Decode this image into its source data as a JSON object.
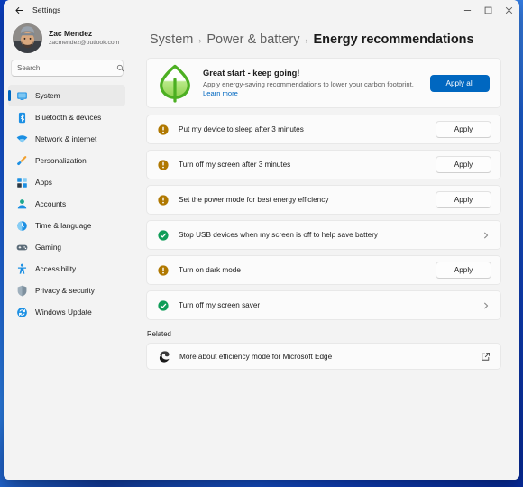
{
  "window": {
    "title": "Settings",
    "back_icon": "back-arrow-icon",
    "minimize_label": "Minimize",
    "maximize_label": "Maximize",
    "close_label": "Close"
  },
  "profile": {
    "name": "Zac Mendez",
    "email": "zacmendez@outlook.com",
    "avatar_name": "user-avatar"
  },
  "search": {
    "placeholder": "Search",
    "value": "",
    "icon": "search-icon"
  },
  "sidebar": {
    "items": [
      {
        "label": "System",
        "icon": "monitor-icon",
        "active": true
      },
      {
        "label": "Bluetooth & devices",
        "icon": "bluetooth-icon",
        "active": false
      },
      {
        "label": "Network & internet",
        "icon": "wifi-icon",
        "active": false
      },
      {
        "label": "Personalization",
        "icon": "paintbrush-icon",
        "active": false
      },
      {
        "label": "Apps",
        "icon": "apps-grid-icon",
        "active": false
      },
      {
        "label": "Accounts",
        "icon": "person-icon",
        "active": false
      },
      {
        "label": "Time & language",
        "icon": "clock-globe-icon",
        "active": false
      },
      {
        "label": "Gaming",
        "icon": "gamepad-icon",
        "active": false
      },
      {
        "label": "Accessibility",
        "icon": "accessibility-person-icon",
        "active": false
      },
      {
        "label": "Privacy & security",
        "icon": "shield-icon",
        "active": false
      },
      {
        "label": "Windows Update",
        "icon": "update-refresh-icon",
        "active": false
      }
    ]
  },
  "breadcrumb": {
    "root": "System",
    "middle": "Power & battery",
    "current": "Energy recommendations",
    "separator": "›"
  },
  "banner": {
    "icon": "leaf-icon",
    "title": "Great start - keep going!",
    "description": "Apply energy-saving recommendations to lower your carbon footprint.",
    "link_text": "Learn more",
    "apply_all_label": "Apply all"
  },
  "recommendations": [
    {
      "label": "Put my device to sleep after 3 minutes",
      "status": "pending",
      "status_icon": "warning-icon",
      "action": "button",
      "action_label": "Apply"
    },
    {
      "label": "Turn off my screen after 3 minutes",
      "status": "pending",
      "status_icon": "warning-icon",
      "action": "button",
      "action_label": "Apply"
    },
    {
      "label": "Set the power mode for best energy efficiency",
      "status": "pending",
      "status_icon": "warning-icon",
      "action": "button",
      "action_label": "Apply"
    },
    {
      "label": "Stop USB devices when my screen is off to help save battery",
      "status": "done",
      "status_icon": "check-circle-icon",
      "action": "chevron",
      "action_label": ""
    },
    {
      "label": "Turn on dark mode",
      "status": "pending",
      "status_icon": "warning-icon",
      "action": "button",
      "action_label": "Apply"
    },
    {
      "label": "Turn off my screen saver",
      "status": "done",
      "status_icon": "check-circle-icon",
      "action": "chevron",
      "action_label": ""
    }
  ],
  "related": {
    "heading": "Related",
    "item_label": "More about efficiency mode for Microsoft Edge",
    "item_icon": "edge-icon",
    "external_icon": "external-link-icon"
  },
  "colors": {
    "accent": "#0067C0",
    "warning": "#B07800",
    "success": "#0F9D58",
    "card": "#FBFBFB",
    "page": "#F3F3F3"
  }
}
